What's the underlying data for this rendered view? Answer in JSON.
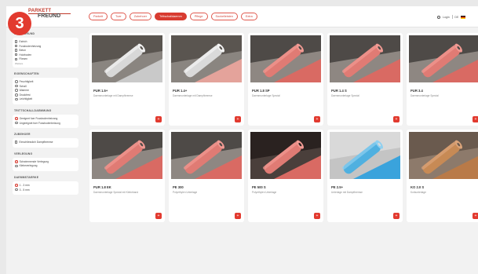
{
  "step_badge": "3",
  "logo": {
    "line1": "PARKETT",
    "line2": "FREUND"
  },
  "nav": {
    "tabs": [
      {
        "label": "Parkett",
        "active": false
      },
      {
        "label": "Tuer",
        "active": false
      },
      {
        "label": "Zubehoer",
        "active": false
      },
      {
        "label": "Trittschalldaemm",
        "active": true
      },
      {
        "label": "Pflege",
        "active": false
      },
      {
        "label": "Sockelleisten",
        "active": false
      },
      {
        "label": "Extra",
        "active": false
      }
    ]
  },
  "header_right": {
    "login": "Login",
    "lang": "DE"
  },
  "sidebar": {
    "groups": [
      {
        "title": "Untergrund",
        "type": "checkbox",
        "options": [
          "Estrich",
          "Fussbodenheizung",
          "Beton",
          "Holzboden",
          "Fliesen"
        ],
        "more": "Weitere"
      },
      {
        "title": "Eigenschaften",
        "type": "radio",
        "options": [
          "Feuchtigkeit",
          "Schall",
          "Waerme",
          "Druckfest",
          "Leichtigkeit"
        ],
        "selected": -1
      },
      {
        "title": "Trittschalldaemmung",
        "type": "radio",
        "options": [
          "Geeignet fuer Fussbodenheizung",
          "Ungeeignet fuer Fussbodenheizung"
        ],
        "selected": 0
      },
      {
        "title": "Zubehoer",
        "type": "checkbox",
        "options": [
          "Einschliesslich Dampfbremse"
        ]
      },
      {
        "title": "Verlegung",
        "type": "radio",
        "options": [
          "Schwimmende Verlegung",
          "Klebeverlegung"
        ],
        "selected": 0
      },
      {
        "title": "Daemmstaerke",
        "type": "radio",
        "options": [
          "1 - 3 mm",
          "3 - 5 mm"
        ],
        "selected": 0
      }
    ]
  },
  "products": [
    {
      "name": "PUR 1.5+",
      "desc": "Daemmunterlage mit Dampfbremse",
      "tone": "silver"
    },
    {
      "name": "PUR 1.4+",
      "desc": "Daemmunterlage mit Dampfbremse",
      "tone": "silver2"
    },
    {
      "name": "PUR 1.8 SP",
      "desc": "Daemmunterlage Spezial",
      "tone": "red"
    },
    {
      "name": "PUR 1.4 S",
      "desc": "Daemmunterlage Spezial",
      "tone": "red"
    },
    {
      "name": "PUR 3.4",
      "desc": "Daemmunterlage Spezial",
      "tone": "red"
    },
    {
      "name": "PUR 1.8 EK",
      "desc": "Daemmunterlage Spezial mit Klebeband",
      "tone": "red"
    },
    {
      "name": "PE 300",
      "desc": "Polyethylen Unterlage",
      "tone": "red"
    },
    {
      "name": "PE 500 S",
      "desc": "Polyethylen Unterlage",
      "tone": "reddark"
    },
    {
      "name": "PE 2.5+",
      "desc": "Unterlage mit Dampfbremse",
      "tone": "blue"
    },
    {
      "name": "KO 2.0 S",
      "desc": "Korkunterlage",
      "tone": "cork"
    }
  ],
  "add_glyph": "+"
}
